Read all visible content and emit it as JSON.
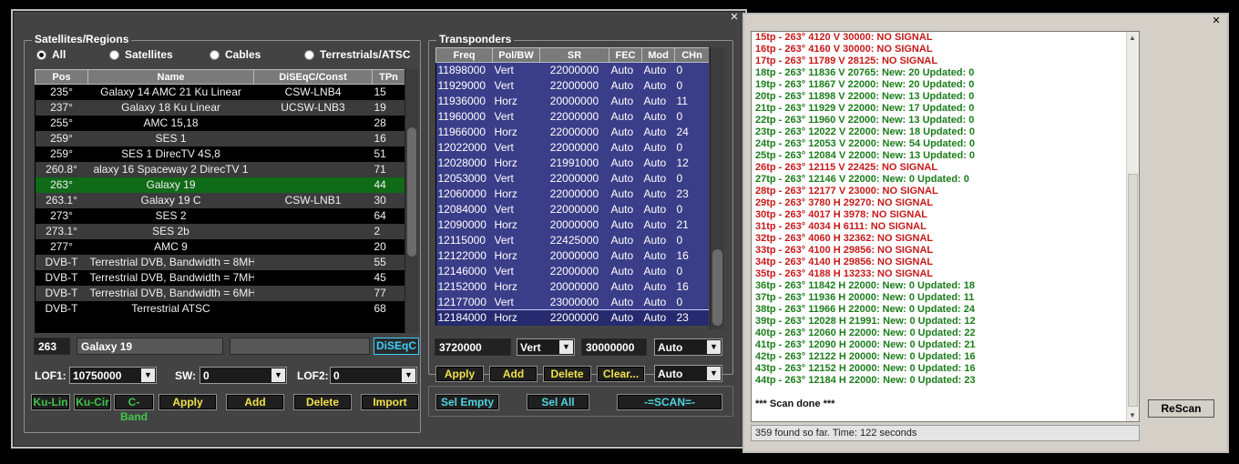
{
  "left_window": {
    "satellites": {
      "title": "Satellites/Regions",
      "filters": [
        {
          "label": "All",
          "selected": true
        },
        {
          "label": "Satellites",
          "selected": false
        },
        {
          "label": "Cables",
          "selected": false
        },
        {
          "label": "Terrestrials/ATSC",
          "selected": false
        }
      ],
      "columns": [
        "Pos",
        "Name",
        "DiSEqC/Const",
        "TPn"
      ],
      "rows": [
        {
          "pos": "235°",
          "name": "Galaxy 14   AMC 21 Ku Linear",
          "diseqc": "CSW-LNB4",
          "tpn": "15"
        },
        {
          "pos": "237°",
          "name": "Galaxy 18 Ku Linear",
          "diseqc": "UCSW-LNB3",
          "tpn": "19"
        },
        {
          "pos": "255°",
          "name": "AMC 15,18",
          "diseqc": "",
          "tpn": "28"
        },
        {
          "pos": "259°",
          "name": "SES 1",
          "diseqc": "",
          "tpn": "16"
        },
        {
          "pos": "259°",
          "name": "SES 1    DirecTV 4S,8",
          "diseqc": "",
          "tpn": "51"
        },
        {
          "pos": "260.8°",
          "name": "alaxy 16    Spaceway 2    DirecTV 1",
          "diseqc": "",
          "tpn": "71"
        },
        {
          "pos": "263°",
          "name": "Galaxy 19",
          "diseqc": "",
          "tpn": "44"
        },
        {
          "pos": "263.1°",
          "name": "Galaxy 19 C",
          "diseqc": "CSW-LNB1",
          "tpn": "30"
        },
        {
          "pos": "273°",
          "name": "SES 2",
          "diseqc": "",
          "tpn": "64"
        },
        {
          "pos": "273.1°",
          "name": "SES 2b",
          "diseqc": "",
          "tpn": "2"
        },
        {
          "pos": "277°",
          "name": "AMC 9",
          "diseqc": "",
          "tpn": "20"
        },
        {
          "pos": "DVB-T",
          "name": "Terrestrial DVB, Bandwidth = 8MH",
          "diseqc": "",
          "tpn": "55"
        },
        {
          "pos": "DVB-T",
          "name": "Terrestrial DVB, Bandwidth = 7MH",
          "diseqc": "",
          "tpn": "45"
        },
        {
          "pos": "DVB-T",
          "name": "Terrestrial DVB, Bandwidth = 6MH",
          "diseqc": "",
          "tpn": "77"
        },
        {
          "pos": "DVB-T",
          "name": "Terrestrial ATSC",
          "diseqc": "",
          "tpn": "68"
        }
      ],
      "selected_row": 6,
      "edit_pos": "263",
      "edit_name": "Galaxy 19",
      "edit_extra": "",
      "diseqc_button": "DiSEqC",
      "lof1_label": "LOF1:",
      "lof1_value": "10750000",
      "sw_label": "SW:",
      "sw_value": "0",
      "lof2_label": "LOF2:",
      "lof2_value": "0",
      "band_buttons": [
        "Ku-Lin",
        "Ku-Cir",
        "C-Band"
      ],
      "actions": [
        "Apply",
        "Add",
        "Delete",
        "Import"
      ]
    },
    "transponders": {
      "title": "Transponders",
      "columns": [
        "Freq",
        "Pol/BW",
        "SR",
        "FEC",
        "Mod",
        "CHn"
      ],
      "rows": [
        [
          "11898000",
          "Vert",
          "22000000",
          "Auto",
          "Auto",
          "0"
        ],
        [
          "11929000",
          "Vert",
          "22000000",
          "Auto",
          "Auto",
          "0"
        ],
        [
          "11936000",
          "Horz",
          "20000000",
          "Auto",
          "Auto",
          "11"
        ],
        [
          "11960000",
          "Vert",
          "22000000",
          "Auto",
          "Auto",
          "0"
        ],
        [
          "11966000",
          "Horz",
          "22000000",
          "Auto",
          "Auto",
          "24"
        ],
        [
          "12022000",
          "Vert",
          "22000000",
          "Auto",
          "Auto",
          "0"
        ],
        [
          "12028000",
          "Horz",
          "21991000",
          "Auto",
          "Auto",
          "12"
        ],
        [
          "12053000",
          "Vert",
          "22000000",
          "Auto",
          "Auto",
          "0"
        ],
        [
          "12060000",
          "Horz",
          "22000000",
          "Auto",
          "Auto",
          "23"
        ],
        [
          "12084000",
          "Vert",
          "22000000",
          "Auto",
          "Auto",
          "0"
        ],
        [
          "12090000",
          "Horz",
          "20000000",
          "Auto",
          "Auto",
          "21"
        ],
        [
          "12115000",
          "Vert",
          "22425000",
          "Auto",
          "Auto",
          "0"
        ],
        [
          "12122000",
          "Horz",
          "20000000",
          "Auto",
          "Auto",
          "16"
        ],
        [
          "12146000",
          "Vert",
          "22000000",
          "Auto",
          "Auto",
          "0"
        ],
        [
          "12152000",
          "Horz",
          "20000000",
          "Auto",
          "Auto",
          "16"
        ],
        [
          "12177000",
          "Vert",
          "23000000",
          "Auto",
          "Auto",
          "0"
        ],
        [
          "12184000",
          "Horz",
          "22000000",
          "Auto",
          "Auto",
          "23"
        ]
      ],
      "edit_freq": "3720000",
      "edit_pol": "Vert",
      "edit_sr": "30000000",
      "edit_fec": "Auto",
      "edit_mod": "Auto",
      "actions": [
        "Apply",
        "Add",
        "Delete",
        "Clear..."
      ],
      "sel_empty": "Sel Empty",
      "sel_all": "Sel All",
      "scan": "-=SCAN=-"
    }
  },
  "right_window": {
    "log": [
      {
        "text": "15tp - 263° 4120 V 30000: NO SIGNAL",
        "color": "red"
      },
      {
        "text": "16tp - 263° 4160 V 30000: NO SIGNAL",
        "color": "red"
      },
      {
        "text": "17tp - 263° 11789 V 28125: NO SIGNAL",
        "color": "red"
      },
      {
        "text": "18tp - 263° 11836 V 20765: New: 20   Updated: 0",
        "color": "green"
      },
      {
        "text": "19tp - 263° 11867 V 22000: New: 20   Updated: 0",
        "color": "green"
      },
      {
        "text": "20tp - 263° 11898 V 22000: New: 13   Updated: 0",
        "color": "green"
      },
      {
        "text": "21tp - 263° 11929 V 22000: New: 17   Updated: 0",
        "color": "green"
      },
      {
        "text": "22tp - 263° 11960 V 22000: New: 13   Updated: 0",
        "color": "green"
      },
      {
        "text": "23tp - 263° 12022 V 22000: New: 18   Updated: 0",
        "color": "green"
      },
      {
        "text": "24tp - 263° 12053 V 22000: New: 54   Updated: 0",
        "color": "green"
      },
      {
        "text": "25tp - 263° 12084 V 22000: New: 13   Updated: 0",
        "color": "green"
      },
      {
        "text": "26tp - 263° 12115 V 22425: NO SIGNAL",
        "color": "red"
      },
      {
        "text": "27tp - 263° 12146 V 22000: New: 0   Updated: 0",
        "color": "green"
      },
      {
        "text": "28tp - 263° 12177 V 23000: NO SIGNAL",
        "color": "red"
      },
      {
        "text": "29tp - 263° 3780 H 29270: NO SIGNAL",
        "color": "red"
      },
      {
        "text": "30tp - 263° 4017 H 3978: NO SIGNAL",
        "color": "red"
      },
      {
        "text": "31tp - 263° 4034 H 6111: NO SIGNAL",
        "color": "red"
      },
      {
        "text": "32tp - 263° 4060 H 32362: NO SIGNAL",
        "color": "red"
      },
      {
        "text": "33tp - 263° 4100 H 29856: NO SIGNAL",
        "color": "red"
      },
      {
        "text": "34tp - 263° 4140 H 29856: NO SIGNAL",
        "color": "red"
      },
      {
        "text": "35tp - 263° 4188 H 13233: NO SIGNAL",
        "color": "red"
      },
      {
        "text": "36tp - 263° 11842 H 22000: New: 0   Updated: 18",
        "color": "green"
      },
      {
        "text": "37tp - 263° 11936 H 20000: New: 0   Updated: 11",
        "color": "green"
      },
      {
        "text": "38tp - 263° 11966 H 22000: New: 0   Updated: 24",
        "color": "green"
      },
      {
        "text": "39tp - 263° 12028 H 21991: New: 0   Updated: 12",
        "color": "green"
      },
      {
        "text": "40tp - 263° 12060 H 22000: New: 0   Updated: 22",
        "color": "green"
      },
      {
        "text": "41tp - 263° 12090 H 20000: New: 0   Updated: 21",
        "color": "green"
      },
      {
        "text": "42tp - 263° 12122 H 20000: New: 0   Updated: 16",
        "color": "green"
      },
      {
        "text": "43tp - 263° 12152 H 20000: New: 0   Updated: 16",
        "color": "green"
      },
      {
        "text": "44tp - 263° 12184 H 22000: New: 0   Updated: 23",
        "color": "green"
      },
      {
        "text": "",
        "color": "black"
      },
      {
        "text": "*** Scan done ***",
        "color": "black"
      }
    ],
    "status": "359 found so far. Time: 122 seconds",
    "rescan": "ReScan"
  },
  "colors": {
    "window_bg": "#434343",
    "selected_row": "#0f6b17",
    "transponder_row": "#3a3d88",
    "log_red": "#c81818",
    "log_green": "#1a7d1a",
    "button_text": "#f0e14a"
  }
}
